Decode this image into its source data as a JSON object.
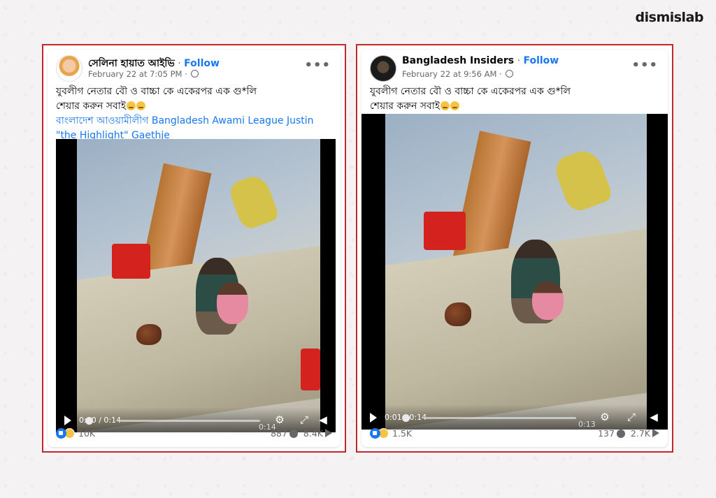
{
  "brand": "dismislab",
  "posts": [
    {
      "author": "সেলিনা হায়াত আইভি",
      "follow": "Follow",
      "sep": "·",
      "date": "February 22 at 7:05 PM ·",
      "more": "•••",
      "text_line1": "যুবলীগ নেতার বৌ ও বাচ্চা কে একেরপর এক গু*লি",
      "text_line2": "শেয়ার করুন সবাই",
      "link_text": "বাংলাদেশ আওয়ামীলীগ Bangladesh Awami League Justin \"the Highlight\" Gaethje",
      "video": {
        "time": "0:00 / 0:14",
        "end": "0:14",
        "progress": 0.0
      },
      "reactions": "10K",
      "comments": "887",
      "shares": "8.4K"
    },
    {
      "author": "Bangladesh Insiders",
      "follow": "Follow",
      "sep": "·",
      "date": "February 22 at 9:56 AM ·",
      "more": "•••",
      "text_line1": "যুবলীগ নেতার বৌ ও বাচ্চা কে একেরপর এক গু*লি",
      "text_line2": "শেয়ার করুন সবাই",
      "video": {
        "time": "0:01 / 0:14",
        "end": "0:13",
        "progress": 0.07
      },
      "reactions": "1.5K",
      "comments": "137",
      "shares": "2.7K"
    }
  ],
  "icons": [
    "globe-icon",
    "more-icon",
    "play-icon",
    "settings-icon",
    "fullscreen-icon",
    "mute-icon",
    "like-reaction-icon",
    "sad-reaction-icon",
    "comment-icon",
    "share-icon"
  ]
}
